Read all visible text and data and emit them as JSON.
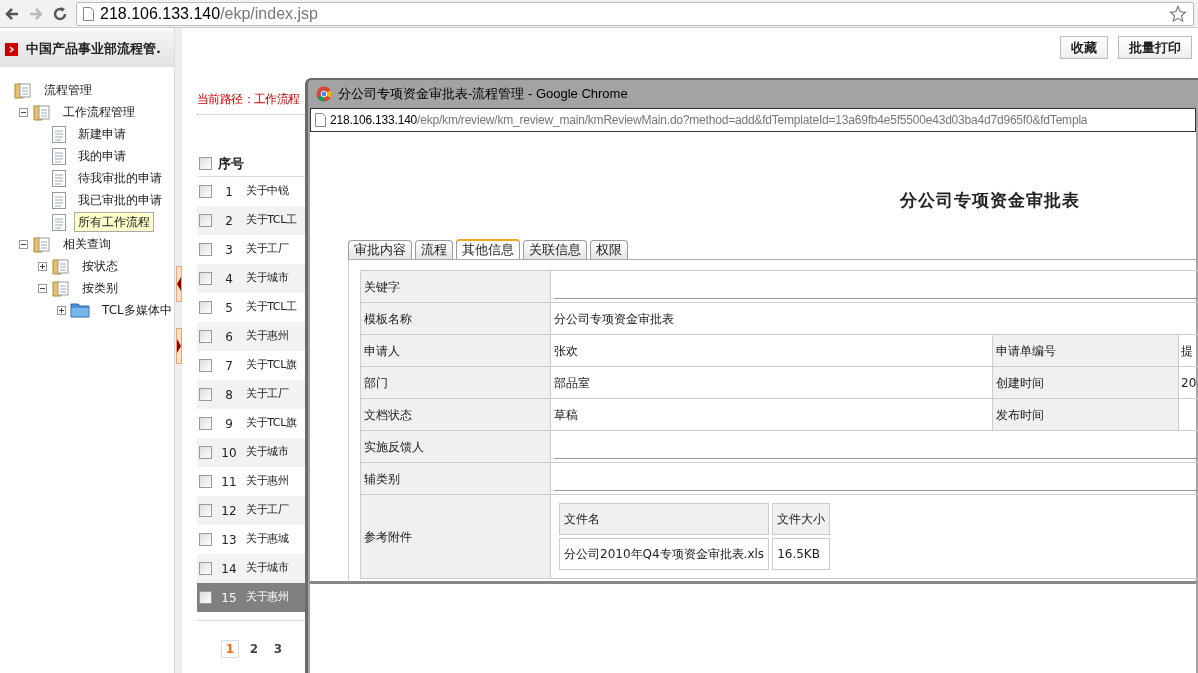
{
  "browser": {
    "url_host": "218.106.133.140",
    "url_path": "/ekp/index.jsp",
    "forward_disabled": true
  },
  "sidebar": {
    "title": "中国产品事业部流程管.",
    "tree": [
      {
        "label": "流程管理",
        "kind": "folder",
        "children": [
          {
            "label": "工作流程管理",
            "kind": "folder",
            "expanded": true,
            "children": [
              {
                "label": "新建申请",
                "kind": "doc",
                "selected": false
              },
              {
                "label": "我的申请",
                "kind": "doc",
                "selected": false
              },
              {
                "label": "待我审批的申请",
                "kind": "doc",
                "selected": false
              },
              {
                "label": "我已审批的申请",
                "kind": "doc",
                "selected": false
              },
              {
                "label": "所有工作流程",
                "kind": "doc",
                "selected": true
              }
            ]
          },
          {
            "label": "相关查询",
            "kind": "folder",
            "expanded": true,
            "children": [
              {
                "label": "按状态",
                "kind": "folder",
                "expanded": false
              },
              {
                "label": "按类别",
                "kind": "folder",
                "expanded": true,
                "children": [
                  {
                    "label": "TCL多媒体中",
                    "kind": "category",
                    "expanded": false
                  }
                ]
              }
            ]
          }
        ]
      }
    ]
  },
  "toolbar": {
    "buttons": [
      "收藏",
      "批量打印"
    ]
  },
  "path": "当前路径：工作流程",
  "list": {
    "header": "序号",
    "all_checked": false,
    "rows": [
      {
        "number": "1",
        "title": "关于中锐",
        "checked": false,
        "selected": false
      },
      {
        "number": "2",
        "title": "关于TCL工",
        "checked": false,
        "selected": false
      },
      {
        "number": "3",
        "title": "关于工厂",
        "checked": false,
        "selected": false
      },
      {
        "number": "4",
        "title": "关于城市",
        "checked": false,
        "selected": false
      },
      {
        "number": "5",
        "title": "关于TCL工",
        "checked": false,
        "selected": false
      },
      {
        "number": "6",
        "title": "关于惠州",
        "checked": false,
        "selected": false
      },
      {
        "number": "7",
        "title": "关于TCL旗",
        "checked": false,
        "selected": false
      },
      {
        "number": "8",
        "title": "关于工厂",
        "checked": false,
        "selected": false
      },
      {
        "number": "9",
        "title": "关于TCL旗",
        "checked": false,
        "selected": false
      },
      {
        "number": "10",
        "title": "关于城市",
        "checked": false,
        "selected": false
      },
      {
        "number": "11",
        "title": "关于惠州",
        "checked": false,
        "selected": false
      },
      {
        "number": "12",
        "title": "关于工厂",
        "checked": false,
        "selected": false
      },
      {
        "number": "13",
        "title": "关于惠城",
        "checked": false,
        "selected": false
      },
      {
        "number": "14",
        "title": "关于城市",
        "checked": false,
        "selected": false
      },
      {
        "number": "15",
        "title": "关于惠州",
        "checked": false,
        "selected": true
      }
    ]
  },
  "pagination": [
    {
      "label": "1",
      "selected": true
    },
    {
      "label": "2",
      "selected": false
    },
    {
      "label": "3",
      "selected": false
    }
  ],
  "popup": {
    "title": "分公司专项资金审批表-流程管理 - Google Chrome",
    "url_host": "218.106.133.140",
    "url_path": "/ekp/km/review/km_review_main/kmReviewMain.do?method=add&fdTemplateId=13a69fb4e5f5500e43d03ba4d7d965f0&fdTempla",
    "heading": "分公司专项资金审批表",
    "tabs": [
      {
        "label": "审批内容",
        "selected": false
      },
      {
        "label": "流程",
        "selected": false
      },
      {
        "label": "其他信息",
        "selected": true
      },
      {
        "label": "关联信息",
        "selected": false
      },
      {
        "label": "权限",
        "selected": false
      }
    ],
    "form": [
      {
        "kind": "line",
        "label": "关键字"
      },
      {
        "kind": "text",
        "label": "模板名称",
        "value": "分公司专项资金审批表"
      },
      {
        "kind": "pair",
        "label": "申请人",
        "value": "张欢",
        "label_2": "申请单编号",
        "value_2": "提"
      },
      {
        "kind": "pair",
        "label": "部门",
        "value": "部品室",
        "label_2": "创建时间",
        "value_2": "20"
      },
      {
        "kind": "pair",
        "label": "文档状态",
        "value": "草稿",
        "label_2": "发布时间"
      },
      {
        "kind": "line",
        "label": "实施反馈人"
      },
      {
        "kind": "line",
        "label": "辅类别"
      },
      {
        "kind": "attachments",
        "label": "参考附件",
        "columns": [
          "文件名",
          "文件大小"
        ],
        "rows": [
          [
            "分公司2010年Q4专项资金审批表.xls",
            "16.5KB"
          ]
        ]
      }
    ]
  }
}
